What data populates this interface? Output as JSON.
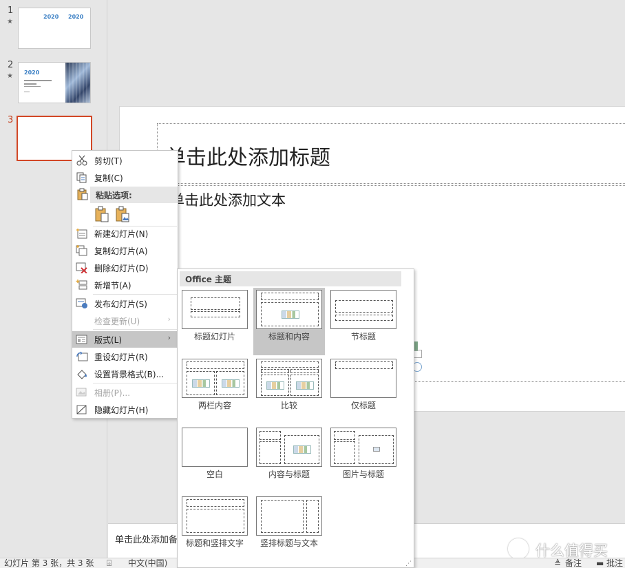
{
  "thumbnails": [
    {
      "number": "1",
      "star": "★",
      "years": [
        "2020",
        "2020"
      ]
    },
    {
      "number": "2",
      "star": "★",
      "year": "2020"
    },
    {
      "number": "3"
    }
  ],
  "slide": {
    "title_placeholder": "单击此处添加标题",
    "body_placeholder": "单击此处添加文本"
  },
  "notes_placeholder": "单击此处添加备注",
  "context_menu": {
    "items": [
      {
        "label": "剪切(T)",
        "icon": "scissors-icon"
      },
      {
        "label": "复制(C)",
        "icon": "copy-icon"
      },
      {
        "label": "新建幻灯片(N)",
        "icon": "new-slide-icon"
      },
      {
        "label": "复制幻灯片(A)",
        "icon": "duplicate-slide-icon"
      },
      {
        "label": "删除幻灯片(D)",
        "icon": "delete-slide-icon"
      },
      {
        "label": "新增节(A)",
        "icon": "add-section-icon"
      },
      {
        "label": "发布幻灯片(S)",
        "icon": "publish-slides-icon"
      },
      {
        "label": "检查更新(U)",
        "disabled": true
      },
      {
        "label": "版式(L)",
        "icon": "layout-icon",
        "highlighted": true
      },
      {
        "label": "重设幻灯片(R)",
        "icon": "reset-slide-icon"
      },
      {
        "label": "设置背景格式(B)...",
        "icon": "format-background-icon"
      },
      {
        "label": "相册(P)...",
        "icon": "photo-album-icon",
        "disabled": true
      },
      {
        "label": "隐藏幻灯片(H)",
        "icon": "hide-slide-icon"
      }
    ],
    "paste_options_label": "粘贴选项:",
    "submenu_arrow": "›"
  },
  "layout_gallery": {
    "header": "Office 主题",
    "layouts": [
      {
        "name": "标题幻灯片"
      },
      {
        "name": "标题和内容",
        "selected": true
      },
      {
        "name": "节标题"
      },
      {
        "name": "两栏内容"
      },
      {
        "name": "比较"
      },
      {
        "name": "仅标题"
      },
      {
        "name": "空白"
      },
      {
        "name": "内容与标题"
      },
      {
        "name": "图片与标题"
      },
      {
        "name": "标题和竖排文字"
      },
      {
        "name": "竖排标题与文本"
      }
    ]
  },
  "status_bar": {
    "slide_info": "幻灯片 第 3 张，共 3 张",
    "language": "中文(中国)",
    "notes_button": "备注",
    "comments_button": "批注"
  },
  "watermark": "什么值得买",
  "colors": {
    "accent": "#d24726",
    "highlight": "#c6c6c6",
    "year_blue": "#3a7fc4"
  }
}
